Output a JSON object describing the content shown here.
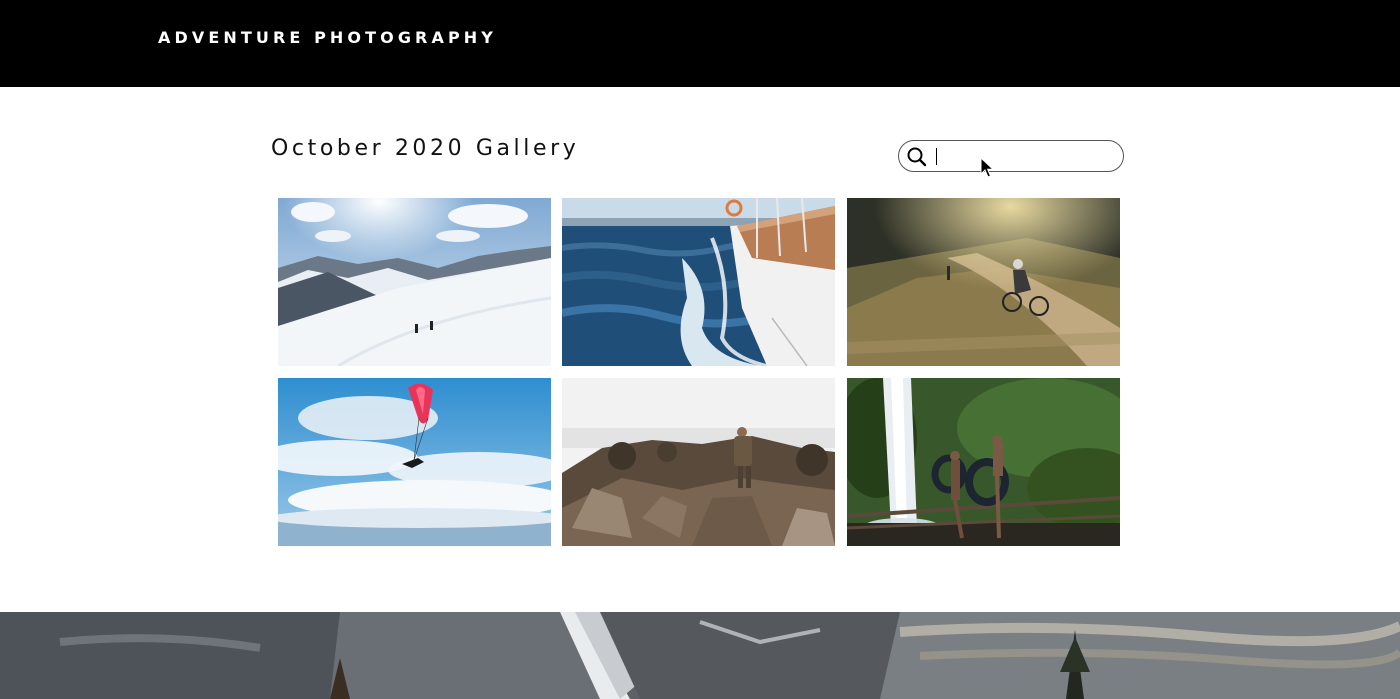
{
  "header": {
    "brand": "ADVENTURE PHOTOGRAPHY"
  },
  "main": {
    "title": "October 2020 Gallery",
    "search": {
      "value": "",
      "placeholder": ""
    }
  },
  "gallery": {
    "photos": [
      {
        "subject": "two hikers on snowy mountain slope"
      },
      {
        "subject": "sailboat hull cutting through ocean waves"
      },
      {
        "subject": "mountain biker on dusty hillside trail"
      },
      {
        "subject": "paraglider with red wing against blue sky"
      },
      {
        "subject": "hiker with backpack among rocks"
      },
      {
        "subject": "people carrying inner tubes near waterfall"
      }
    ]
  },
  "banner": {
    "subject": "rocky mountain cliff face"
  },
  "icons": {
    "search": "search-icon",
    "cursor": "mouse-pointer-icon"
  }
}
